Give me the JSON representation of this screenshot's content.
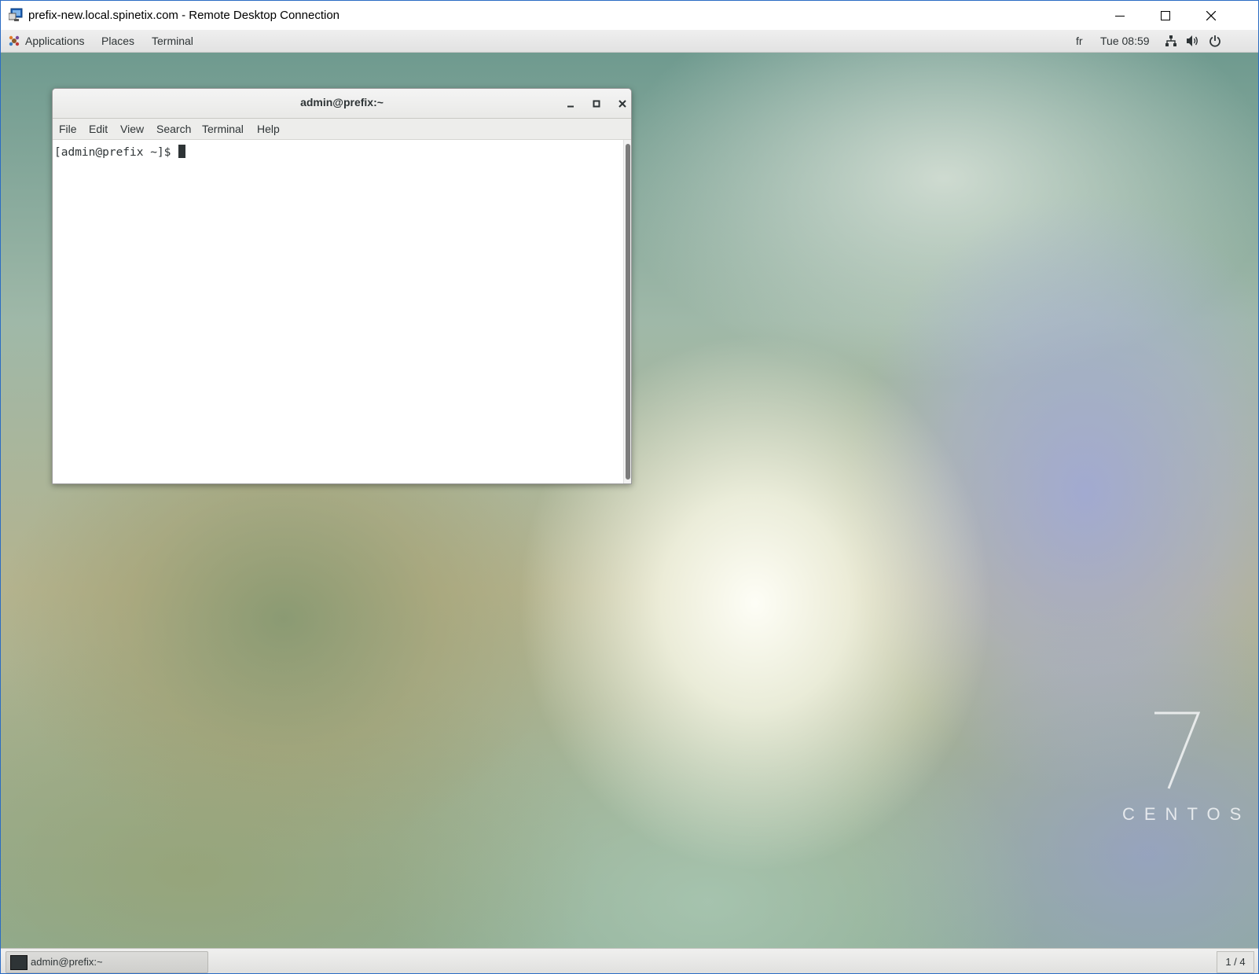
{
  "rdp_window": {
    "title": "prefix-new.local.spinetix.com - Remote Desktop Connection",
    "icon": "remote-desktop-icon",
    "controls": [
      "minimize-icon",
      "maximize-icon",
      "close-icon"
    ]
  },
  "gnome_panel": {
    "menus": [
      "Applications",
      "Places",
      "Terminal"
    ],
    "keyboard_layout": "fr",
    "clock": "Tue 08:59",
    "status_icons": [
      "network-icon",
      "volume-icon",
      "power-icon"
    ]
  },
  "terminal": {
    "title": "admin@prefix:~",
    "menu": [
      "File",
      "Edit",
      "View",
      "Search",
      "Terminal",
      "Help"
    ],
    "prompt": "[admin@prefix ~]$ ",
    "buttons": [
      "minimize-icon",
      "maximize-icon",
      "close-icon"
    ]
  },
  "desktop": {
    "branding_number": "7",
    "branding_text": "CENTOS"
  },
  "taskbar": {
    "task_label": "admin@prefix:~",
    "workspace": "1 / 4"
  },
  "colors": {
    "rdp_frame": "#2b6cc4",
    "panel_bg": "#e8e8e7",
    "terminal_text": "#2e3436"
  }
}
